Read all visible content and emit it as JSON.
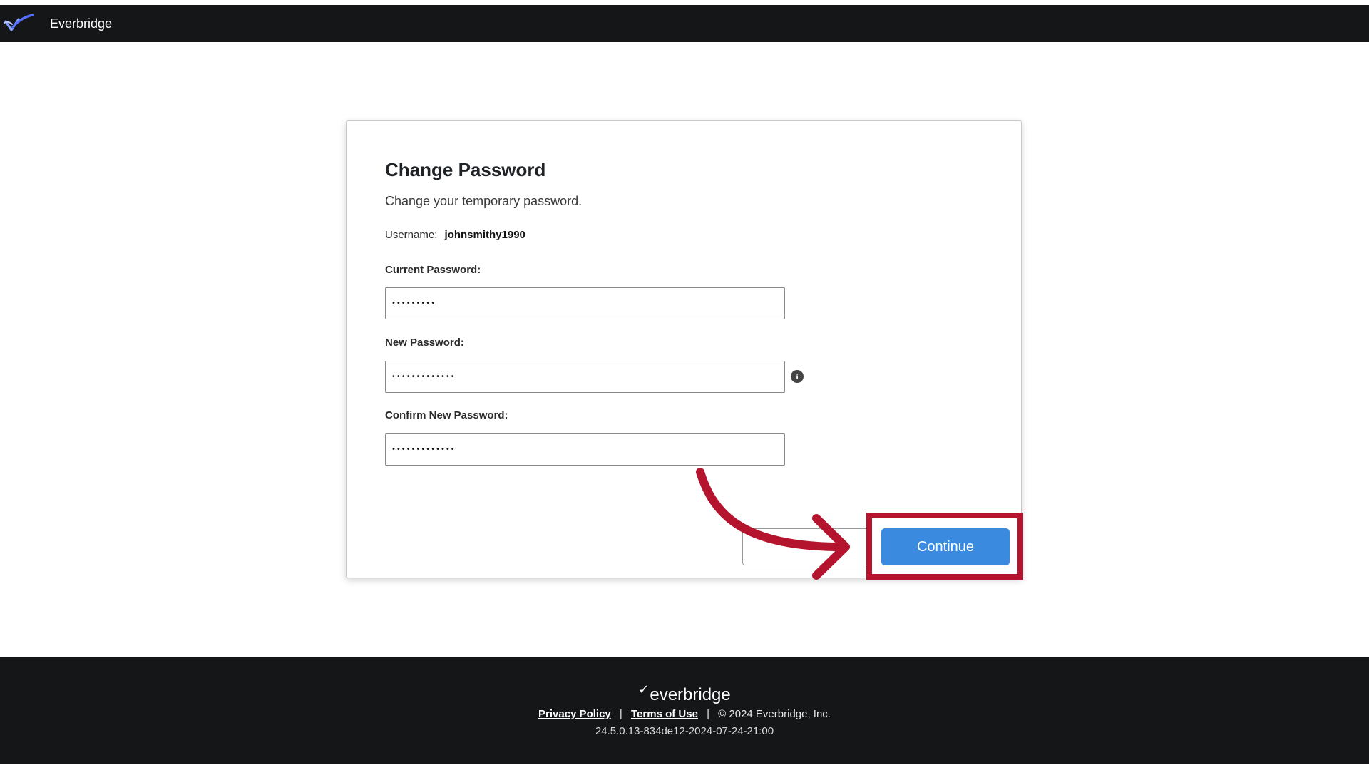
{
  "header": {
    "brand": "Everbridge",
    "logo_icon": "everbridge-bird-icon"
  },
  "card": {
    "title": "Change Password",
    "subtitle": "Change your temporary password.",
    "username_label": "Username:",
    "username_value": "johnsmithy1990",
    "current_password": {
      "label": "Current Password:",
      "value": "•••••••••"
    },
    "new_password": {
      "label": "New Password:",
      "value": "•••••••••••••"
    },
    "confirm_password": {
      "label": "Confirm New Password:",
      "value": "•••••••••••••"
    },
    "continue_label": "Continue",
    "info_icon": "info-icon"
  },
  "footer": {
    "logo_text": "everbridge",
    "privacy_label": "Privacy Policy",
    "terms_label": "Terms of Use",
    "separator": "|",
    "copyright": "© 2024 Everbridge, Inc.",
    "version": "24.5.0.13-834de12-2024-07-24-21:00"
  },
  "colors": {
    "topbar": "#141618",
    "primary_button": "#3a8ae0",
    "annotation": "#b4142d"
  }
}
